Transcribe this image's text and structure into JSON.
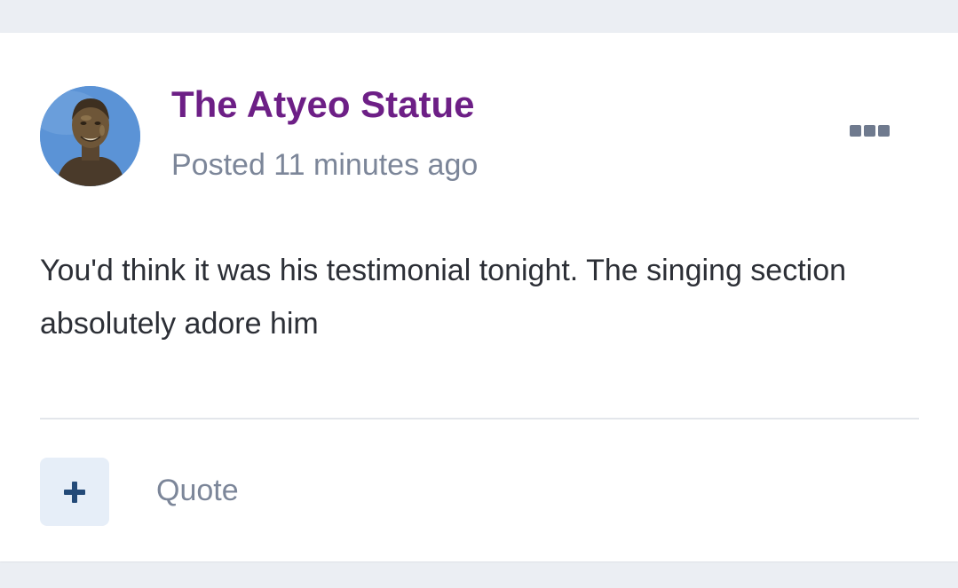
{
  "post": {
    "author": "The Atyeo Statue",
    "timestamp": "Posted 11 minutes ago",
    "content": "You'd think it was his testimonial tonight. The singing section absolutely adore him",
    "more_icon": "ellipsis-icon",
    "actions": {
      "add_icon": "plus-icon",
      "quote_label": "Quote"
    }
  },
  "colors": {
    "author": "#6d1f86",
    "muted_text": "#7c8699",
    "body_text": "#2c2f36",
    "page_background": "#ebeef3",
    "plus_button_bg": "#e6eef8",
    "plus_icon": "#234a78"
  }
}
